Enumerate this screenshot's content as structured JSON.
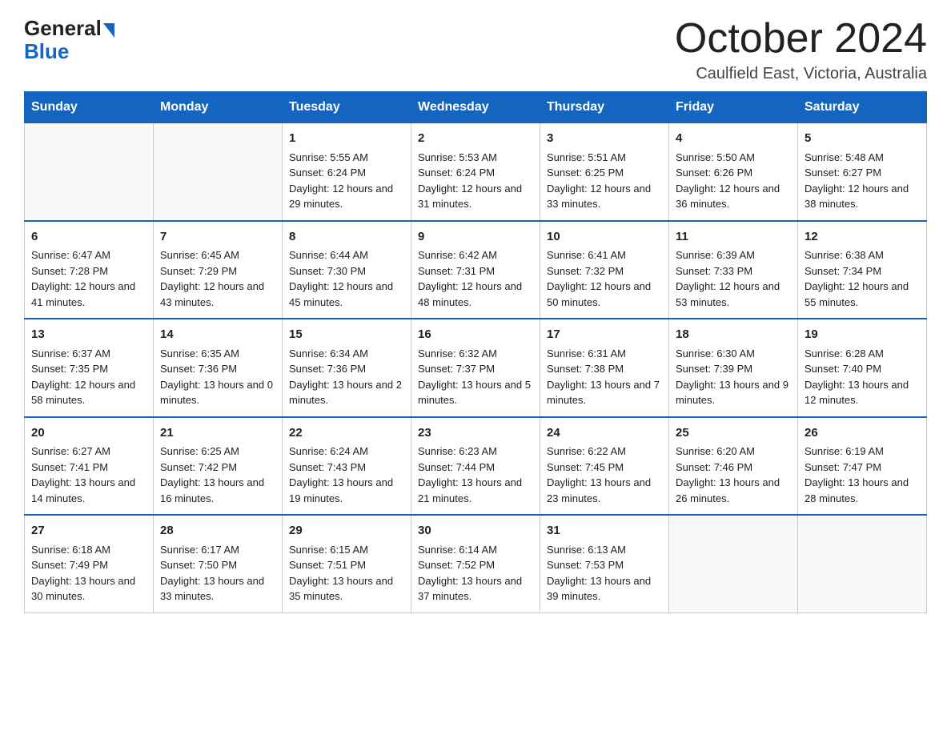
{
  "header": {
    "logo_general": "General",
    "logo_blue": "Blue",
    "month_title": "October 2024",
    "location": "Caulfield East, Victoria, Australia"
  },
  "days_of_week": [
    "Sunday",
    "Monday",
    "Tuesday",
    "Wednesday",
    "Thursday",
    "Friday",
    "Saturday"
  ],
  "weeks": [
    [
      {
        "day": "",
        "sunrise": "",
        "sunset": "",
        "daylight": ""
      },
      {
        "day": "",
        "sunrise": "",
        "sunset": "",
        "daylight": ""
      },
      {
        "day": "1",
        "sunrise": "Sunrise: 5:55 AM",
        "sunset": "Sunset: 6:24 PM",
        "daylight": "Daylight: 12 hours and 29 minutes."
      },
      {
        "day": "2",
        "sunrise": "Sunrise: 5:53 AM",
        "sunset": "Sunset: 6:24 PM",
        "daylight": "Daylight: 12 hours and 31 minutes."
      },
      {
        "day": "3",
        "sunrise": "Sunrise: 5:51 AM",
        "sunset": "Sunset: 6:25 PM",
        "daylight": "Daylight: 12 hours and 33 minutes."
      },
      {
        "day": "4",
        "sunrise": "Sunrise: 5:50 AM",
        "sunset": "Sunset: 6:26 PM",
        "daylight": "Daylight: 12 hours and 36 minutes."
      },
      {
        "day": "5",
        "sunrise": "Sunrise: 5:48 AM",
        "sunset": "Sunset: 6:27 PM",
        "daylight": "Daylight: 12 hours and 38 minutes."
      }
    ],
    [
      {
        "day": "6",
        "sunrise": "Sunrise: 6:47 AM",
        "sunset": "Sunset: 7:28 PM",
        "daylight": "Daylight: 12 hours and 41 minutes."
      },
      {
        "day": "7",
        "sunrise": "Sunrise: 6:45 AM",
        "sunset": "Sunset: 7:29 PM",
        "daylight": "Daylight: 12 hours and 43 minutes."
      },
      {
        "day": "8",
        "sunrise": "Sunrise: 6:44 AM",
        "sunset": "Sunset: 7:30 PM",
        "daylight": "Daylight: 12 hours and 45 minutes."
      },
      {
        "day": "9",
        "sunrise": "Sunrise: 6:42 AM",
        "sunset": "Sunset: 7:31 PM",
        "daylight": "Daylight: 12 hours and 48 minutes."
      },
      {
        "day": "10",
        "sunrise": "Sunrise: 6:41 AM",
        "sunset": "Sunset: 7:32 PM",
        "daylight": "Daylight: 12 hours and 50 minutes."
      },
      {
        "day": "11",
        "sunrise": "Sunrise: 6:39 AM",
        "sunset": "Sunset: 7:33 PM",
        "daylight": "Daylight: 12 hours and 53 minutes."
      },
      {
        "day": "12",
        "sunrise": "Sunrise: 6:38 AM",
        "sunset": "Sunset: 7:34 PM",
        "daylight": "Daylight: 12 hours and 55 minutes."
      }
    ],
    [
      {
        "day": "13",
        "sunrise": "Sunrise: 6:37 AM",
        "sunset": "Sunset: 7:35 PM",
        "daylight": "Daylight: 12 hours and 58 minutes."
      },
      {
        "day": "14",
        "sunrise": "Sunrise: 6:35 AM",
        "sunset": "Sunset: 7:36 PM",
        "daylight": "Daylight: 13 hours and 0 minutes."
      },
      {
        "day": "15",
        "sunrise": "Sunrise: 6:34 AM",
        "sunset": "Sunset: 7:36 PM",
        "daylight": "Daylight: 13 hours and 2 minutes."
      },
      {
        "day": "16",
        "sunrise": "Sunrise: 6:32 AM",
        "sunset": "Sunset: 7:37 PM",
        "daylight": "Daylight: 13 hours and 5 minutes."
      },
      {
        "day": "17",
        "sunrise": "Sunrise: 6:31 AM",
        "sunset": "Sunset: 7:38 PM",
        "daylight": "Daylight: 13 hours and 7 minutes."
      },
      {
        "day": "18",
        "sunrise": "Sunrise: 6:30 AM",
        "sunset": "Sunset: 7:39 PM",
        "daylight": "Daylight: 13 hours and 9 minutes."
      },
      {
        "day": "19",
        "sunrise": "Sunrise: 6:28 AM",
        "sunset": "Sunset: 7:40 PM",
        "daylight": "Daylight: 13 hours and 12 minutes."
      }
    ],
    [
      {
        "day": "20",
        "sunrise": "Sunrise: 6:27 AM",
        "sunset": "Sunset: 7:41 PM",
        "daylight": "Daylight: 13 hours and 14 minutes."
      },
      {
        "day": "21",
        "sunrise": "Sunrise: 6:25 AM",
        "sunset": "Sunset: 7:42 PM",
        "daylight": "Daylight: 13 hours and 16 minutes."
      },
      {
        "day": "22",
        "sunrise": "Sunrise: 6:24 AM",
        "sunset": "Sunset: 7:43 PM",
        "daylight": "Daylight: 13 hours and 19 minutes."
      },
      {
        "day": "23",
        "sunrise": "Sunrise: 6:23 AM",
        "sunset": "Sunset: 7:44 PM",
        "daylight": "Daylight: 13 hours and 21 minutes."
      },
      {
        "day": "24",
        "sunrise": "Sunrise: 6:22 AM",
        "sunset": "Sunset: 7:45 PM",
        "daylight": "Daylight: 13 hours and 23 minutes."
      },
      {
        "day": "25",
        "sunrise": "Sunrise: 6:20 AM",
        "sunset": "Sunset: 7:46 PM",
        "daylight": "Daylight: 13 hours and 26 minutes."
      },
      {
        "day": "26",
        "sunrise": "Sunrise: 6:19 AM",
        "sunset": "Sunset: 7:47 PM",
        "daylight": "Daylight: 13 hours and 28 minutes."
      }
    ],
    [
      {
        "day": "27",
        "sunrise": "Sunrise: 6:18 AM",
        "sunset": "Sunset: 7:49 PM",
        "daylight": "Daylight: 13 hours and 30 minutes."
      },
      {
        "day": "28",
        "sunrise": "Sunrise: 6:17 AM",
        "sunset": "Sunset: 7:50 PM",
        "daylight": "Daylight: 13 hours and 33 minutes."
      },
      {
        "day": "29",
        "sunrise": "Sunrise: 6:15 AM",
        "sunset": "Sunset: 7:51 PM",
        "daylight": "Daylight: 13 hours and 35 minutes."
      },
      {
        "day": "30",
        "sunrise": "Sunrise: 6:14 AM",
        "sunset": "Sunset: 7:52 PM",
        "daylight": "Daylight: 13 hours and 37 minutes."
      },
      {
        "day": "31",
        "sunrise": "Sunrise: 6:13 AM",
        "sunset": "Sunset: 7:53 PM",
        "daylight": "Daylight: 13 hours and 39 minutes."
      },
      {
        "day": "",
        "sunrise": "",
        "sunset": "",
        "daylight": ""
      },
      {
        "day": "",
        "sunrise": "",
        "sunset": "",
        "daylight": ""
      }
    ]
  ]
}
